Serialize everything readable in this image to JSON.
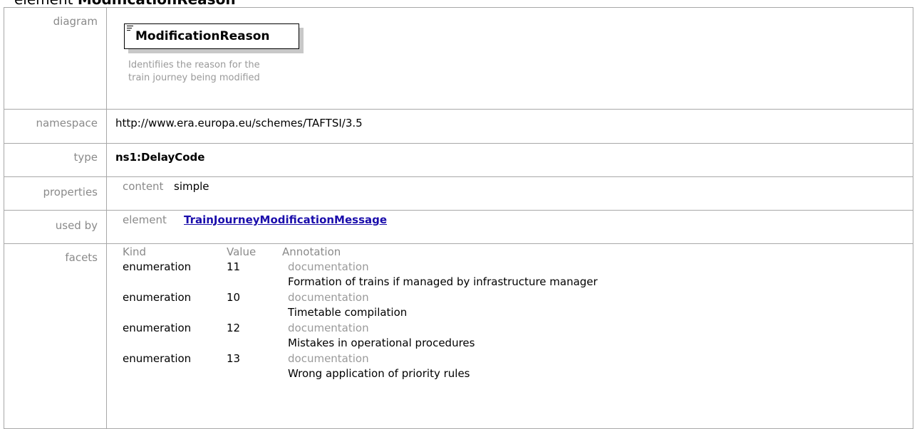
{
  "heading": {
    "prefix": "element ",
    "name": "ModificationReason"
  },
  "rows": {
    "diagram": {
      "label": "diagram",
      "box_name": "ModificationReason",
      "box_doc": "Identifiies the reason for the train journey being modified"
    },
    "namespace": {
      "label": "namespace",
      "value": "http://www.era.europa.eu/schemes/TAFTSI/3.5"
    },
    "type": {
      "label": "type",
      "value": "ns1:DelayCode"
    },
    "properties": {
      "label": "properties",
      "key": "content",
      "value": "simple"
    },
    "used_by": {
      "label": "used by",
      "key": "element",
      "link": "TrainJourneyModificationMessage"
    },
    "facets": {
      "label": "facets",
      "headers": [
        "Kind",
        "Value",
        "Annotation"
      ],
      "items": [
        {
          "kind": "enumeration",
          "value": "11",
          "annotation_label": "documentation",
          "annotation": "Formation of trains if managed by infrastructure manager"
        },
        {
          "kind": "enumeration",
          "value": "10",
          "annotation_label": "documentation",
          "annotation": "Timetable compilation"
        },
        {
          "kind": "enumeration",
          "value": "12",
          "annotation_label": "documentation",
          "annotation": "Mistakes in operational procedures"
        },
        {
          "kind": "enumeration",
          "value": "13",
          "annotation_label": "documentation",
          "annotation": "Wrong application of priority rules"
        }
      ]
    }
  }
}
